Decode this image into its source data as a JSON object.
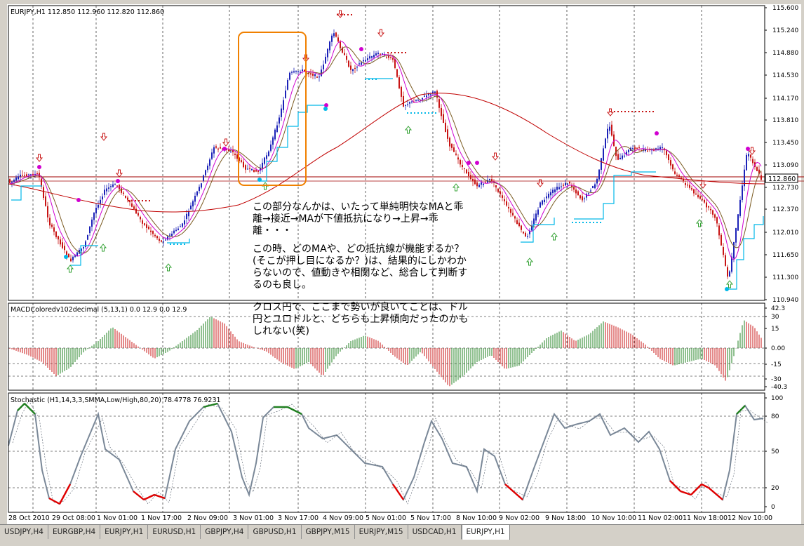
{
  "main_chart": {
    "label": "EURJPY,H1  112.850 112.960 112.820 112.860",
    "price_axis": [
      "115.600",
      "115.240",
      "114.880",
      "114.530",
      "114.170",
      "113.810",
      "113.450",
      "113.090",
      "112.730",
      "112.370",
      "112.010",
      "111.650",
      "111.300",
      "110.940"
    ],
    "current_price": "112.860"
  },
  "macd": {
    "label": "MACDColoredv102decimal (5,13,1) 0.0 12.9 0.0 12.9",
    "axis": [
      "42.3",
      "30",
      "15",
      "0.00",
      "-15",
      "-30",
      "-40.3"
    ]
  },
  "stochastic": {
    "label": "Stochastic (H1,14,3,3,SMMA,Low/High,80,20) 78.4778 76.9231",
    "axis": [
      "100",
      "80",
      "50",
      "20",
      "0"
    ]
  },
  "time_axis": [
    "28 Oct 2010",
    "29 Oct 08:00",
    "1 Nov 01:00",
    "1 Nov 17:00",
    "2 Nov 09:00",
    "3 Nov 01:00",
    "3 Nov 17:00",
    "4 Nov 09:00",
    "5 Nov 01:00",
    "5 Nov 17:00",
    "8 Nov 10:00",
    "9 Nov 02:00",
    "9 Nov 18:00",
    "10 Nov 10:00",
    "11 Nov 02:00",
    "11 Nov 18:00",
    "12 Nov 10:00"
  ],
  "annotation": {
    "para1": "この部分なんかは、いたって単純明快なMAと乖離→接近→MAが下値抵抗になり→上昇→乖離・・・",
    "para2": "この時、どのMAや、どの抵抗線が機能するか？(そこが押し目になるか？)は、結果的にしかわからないので、値動きや相関など、総合して判断するのも良し。",
    "para3": "クロス円で、ここまで勢いが良いてことは、ドル円とユロドルと、どちらも上昇傾向だったのかもしれない(笑)"
  },
  "tabs": [
    "USDJPY,H4",
    "EURGBP,H4",
    "EURJPY,H1",
    "EURUSD,H1",
    "GBPJPY,H4",
    "GBPUSD,H1",
    "GBPJPY,M15",
    "EURJPY,M15",
    "USDCAD,H1",
    "EURJPY,H1"
  ],
  "active_tab": 9,
  "colors": {
    "bull": "#1c22b8",
    "bear": "#c81414",
    "ma_red": "#c00000",
    "ma_magenta": "#d000d0",
    "ma_cyan": "#00b8e8",
    "ma_olive": "#7a5a20",
    "stoch_main": "#7a8898",
    "stoch_up": "#208020",
    "stoch_down": "#e00000",
    "highlight": "#f08000"
  }
}
